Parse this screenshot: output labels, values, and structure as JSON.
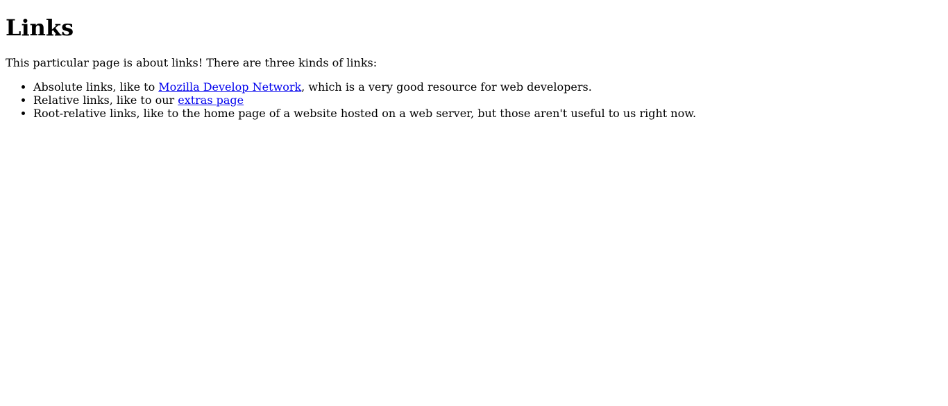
{
  "page": {
    "title": "Links",
    "intro": "This particular page is about links! There are three kinds of links:"
  },
  "links_list": {
    "items": [
      {
        "before": "Absolute links, like to ",
        "link_text": "Mozilla Develop Network",
        "after": ", which is a very good resource for web developers."
      },
      {
        "before": "Relative links, like to our ",
        "link_text": "extras page",
        "after": ""
      },
      {
        "text": "Root-relative links, like to the home page of a website hosted on a web server, but those aren't useful to us right now."
      }
    ]
  },
  "colors": {
    "link": "#0000ee",
    "text": "#000000",
    "background": "#ffffff"
  }
}
